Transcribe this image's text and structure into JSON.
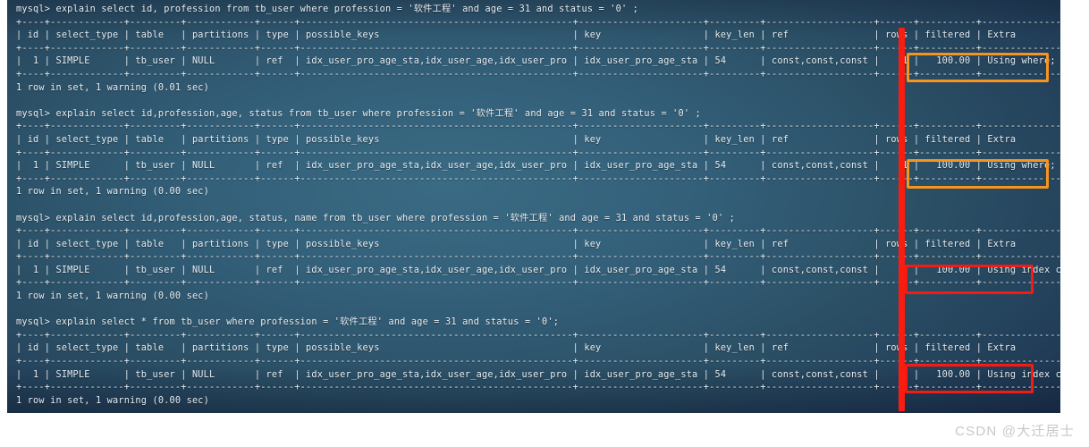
{
  "window": {
    "type": "mysql-terminal",
    "background_color": "#335f79",
    "text_color": "#e8eef2"
  },
  "annotations": {
    "vertical_line_color": "#fb1c10",
    "orange_box_color": "#f7941e",
    "red_box_color": "#f51b12"
  },
  "watermark": {
    "text": "CSDN @大迁居士"
  },
  "table": {
    "columns": [
      "id",
      "select_type",
      "table",
      "partitions",
      "type",
      "possible_keys",
      "key",
      "key_len",
      "ref",
      "rows",
      "filtered",
      "Extra"
    ],
    "row": {
      "id": "1",
      "select_type": "SIMPLE",
      "table": "tb_user",
      "partitions": "NULL",
      "type": "ref",
      "possible_keys": "idx_user_pro_age_sta,idx_user_age,idx_user_pro",
      "key": "idx_user_pro_age_sta",
      "key_len": "54",
      "ref": "const,const,const",
      "rows": "1",
      "filtered": "100.00"
    }
  },
  "blocks": [
    {
      "prompt": "mysql> ",
      "query": "explain select id, profession from tb_user where profession = '软件工程' and age = 31 and status = '0' ;",
      "extra": "Using where; Using index",
      "highlight": "orange",
      "footer": "1 row in set, 1 warning (0.01 sec)",
      "rule_top": "+----+-------------+---------+------------+------+----------------------------------------------+----------------------+---------+-------------------+------+----------+------------------------+",
      "header_line": "| id | select_type | table   | partitions | type | possible_keys                                | key                  | key_len | ref               | rows | filtered | Extra                  |",
      "rule_mid": "+----+-------------+---------+------------+------+----------------------------------------------+----------------------+---------+-------------------+------+----------+------------------------+",
      "data_line": "|  1 | SIMPLE      | tb_user | NULL       | ref  | idx_user_pro_age_sta,idx_user_age,idx_user_pro | idx_user_pro_age_sta | 54      | const,const,const |    1 |   100.00 | Using where; Using index |",
      "rule_bot": "+----+-------------+---------+------------+------+----------------------------------------------+----------------------+---------+-------------------+------+----------+------------------------+"
    },
    {
      "prompt": "mysql> ",
      "query": "explain select id,profession,age, status from tb_user where profession = '软件工程' and age = 31 and status = '0' ;",
      "extra": "Using where; Using index",
      "highlight": "orange",
      "footer": "1 row in set, 1 warning (0.00 sec)"
    },
    {
      "prompt": "mysql> ",
      "query": "explain select id,profession,age, status, name from tb_user where profession = '软件工程' and age = 31 and status = '0' ;",
      "extra": "Using index condition",
      "highlight": "red",
      "footer": "1 row in set, 1 warning (0.00 sec)"
    },
    {
      "prompt": "mysql> ",
      "query": "explain select * from tb_user where profession = '软件工程' and age = 31 and status = '0';",
      "extra": "Using index condition",
      "highlight": "red",
      "footer": "1 row in set, 1 warning (0.00 sec)"
    }
  ]
}
